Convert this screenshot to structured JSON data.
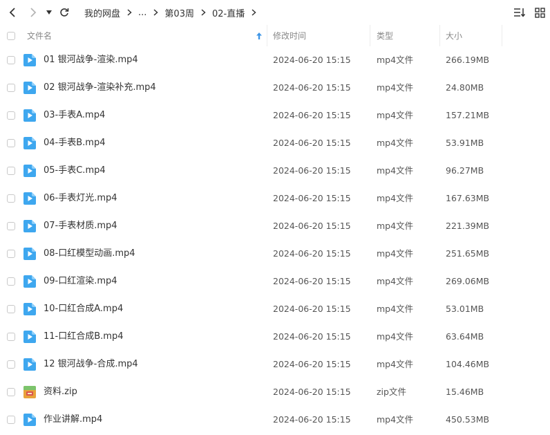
{
  "breadcrumb": [
    {
      "label": "我的网盘"
    },
    {
      "label": "..."
    },
    {
      "label": "第03周"
    },
    {
      "label": "02-直播"
    }
  ],
  "columns": {
    "name": "文件名",
    "modified": "修改时间",
    "type": "类型",
    "size": "大小"
  },
  "sort": {
    "column": "name",
    "direction": "ascending"
  },
  "colors": {
    "video_icon": "#3ea7ef",
    "zip_icon": "#e9a23b",
    "sort_arrow": "#3e95e6"
  },
  "files": [
    {
      "name": "01 银河战争-渲染.mp4",
      "modified": "2024-06-20 15:15",
      "type": "mp4文件",
      "size": "266.19MB",
      "icon": "video-file-icon"
    },
    {
      "name": "02 银河战争-渲染补充.mp4",
      "modified": "2024-06-20 15:15",
      "type": "mp4文件",
      "size": "24.80MB",
      "icon": "video-file-icon"
    },
    {
      "name": "03-手表A.mp4",
      "modified": "2024-06-20 15:15",
      "type": "mp4文件",
      "size": "157.21MB",
      "icon": "video-file-icon"
    },
    {
      "name": "04-手表B.mp4",
      "modified": "2024-06-20 15:15",
      "type": "mp4文件",
      "size": "53.91MB",
      "icon": "video-file-icon"
    },
    {
      "name": "05-手表C.mp4",
      "modified": "2024-06-20 15:15",
      "type": "mp4文件",
      "size": "96.27MB",
      "icon": "video-file-icon"
    },
    {
      "name": "06-手表灯光.mp4",
      "modified": "2024-06-20 15:15",
      "type": "mp4文件",
      "size": "167.63MB",
      "icon": "video-file-icon"
    },
    {
      "name": "07-手表材质.mp4",
      "modified": "2024-06-20 15:15",
      "type": "mp4文件",
      "size": "221.39MB",
      "icon": "video-file-icon"
    },
    {
      "name": "08-口红模型动画.mp4",
      "modified": "2024-06-20 15:15",
      "type": "mp4文件",
      "size": "251.65MB",
      "icon": "video-file-icon"
    },
    {
      "name": "09-口红渲染.mp4",
      "modified": "2024-06-20 15:15",
      "type": "mp4文件",
      "size": "269.06MB",
      "icon": "video-file-icon"
    },
    {
      "name": "10-口红合成A.mp4",
      "modified": "2024-06-20 15:15",
      "type": "mp4文件",
      "size": "53.01MB",
      "icon": "video-file-icon"
    },
    {
      "name": "11-口红合成B.mp4",
      "modified": "2024-06-20 15:15",
      "type": "mp4文件",
      "size": "63.64MB",
      "icon": "video-file-icon"
    },
    {
      "name": "12 银河战争-合成.mp4",
      "modified": "2024-06-20 15:15",
      "type": "mp4文件",
      "size": "104.46MB",
      "icon": "video-file-icon"
    },
    {
      "name": "资料.zip",
      "modified": "2024-06-20 15:15",
      "type": "zip文件",
      "size": "15.46MB",
      "icon": "zip-file-icon"
    },
    {
      "name": "作业讲解.mp4",
      "modified": "2024-06-20 15:15",
      "type": "mp4文件",
      "size": "450.53MB",
      "icon": "video-file-icon"
    }
  ]
}
